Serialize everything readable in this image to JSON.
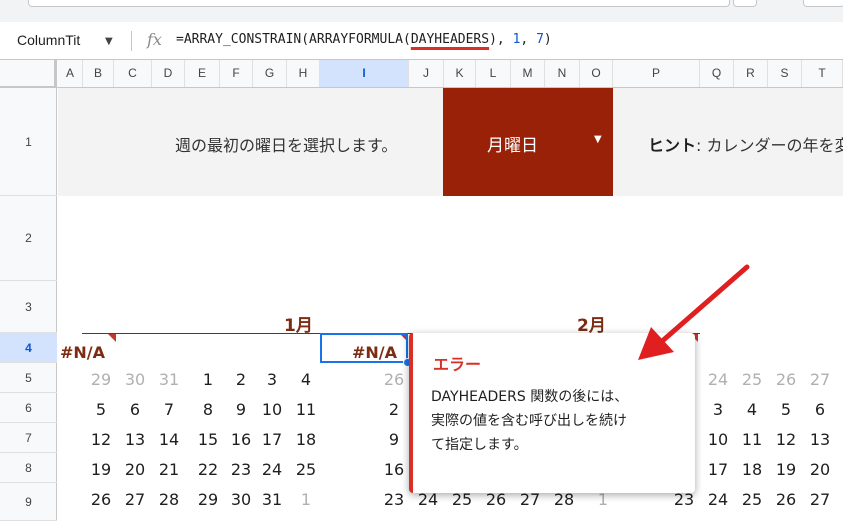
{
  "formula_bar": {
    "name_box": "ColumnTit",
    "fx_label": "fx",
    "formula_before": "=ARRAY_CONSTRAIN(ARRAYFORMULA(",
    "formula_error_part": "DAYHEADERS",
    "formula_mid1": "), ",
    "formula_num1": "1",
    "formula_mid2": ", ",
    "formula_num2": "7",
    "formula_after": ")"
  },
  "columns": [
    "A",
    "B",
    "C",
    "D",
    "E",
    "F",
    "G",
    "H",
    "I",
    "J",
    "K",
    "L",
    "M",
    "N",
    "O",
    "P",
    "Q",
    "R",
    "S",
    "T"
  ],
  "selected_column": "I",
  "rows": [
    "1",
    "2",
    "3",
    "4",
    "5",
    "6",
    "7",
    "8",
    "9"
  ],
  "selected_row": "4",
  "sheet": {
    "hint_left": "週の最初の曜日を選択します。",
    "month_select_value": "月曜日",
    "hint_right_bold": "ヒント",
    "hint_right_rest": ": カレンダーの年を変",
    "jan_title": "1月",
    "feb_title": "2月",
    "na_jan": "#N/A",
    "na_feb": "#N/A",
    "jan_days": [
      [
        "29",
        "30",
        "31",
        "1",
        "2",
        "3",
        "4"
      ],
      [
        "5",
        "6",
        "7",
        "8",
        "9",
        "10",
        "11"
      ],
      [
        "12",
        "13",
        "14",
        "15",
        "16",
        "17",
        "18"
      ],
      [
        "19",
        "20",
        "21",
        "22",
        "23",
        "24",
        "25"
      ],
      [
        "26",
        "27",
        "28",
        "29",
        "30",
        "31",
        "1"
      ]
    ],
    "feb_days_left": [
      "26",
      "2",
      "9",
      "16",
      "23"
    ],
    "feb_days_row9_extra": [
      "24",
      "25",
      "26",
      "27",
      "28",
      "1"
    ],
    "mar_days": [
      [
        "24",
        "25",
        "26",
        "27"
      ],
      [
        "3",
        "4",
        "5",
        "6"
      ],
      [
        "10",
        "11",
        "12",
        "13"
      ],
      [
        "17",
        "18",
        "19",
        "20"
      ],
      [
        "23",
        "24",
        "25",
        "26",
        "27"
      ]
    ]
  },
  "tooltip": {
    "title": "エラー",
    "line1": "DAYHEADERS 関数の後には、",
    "line2": "実際の値を含む呼び出しを続け",
    "line3": "て指定します。"
  },
  "colors": {
    "accent_dark_red": "#992108",
    "error_red": "#d93025",
    "month_title": "#7b2c12",
    "selection_blue": "#1a73e8"
  }
}
